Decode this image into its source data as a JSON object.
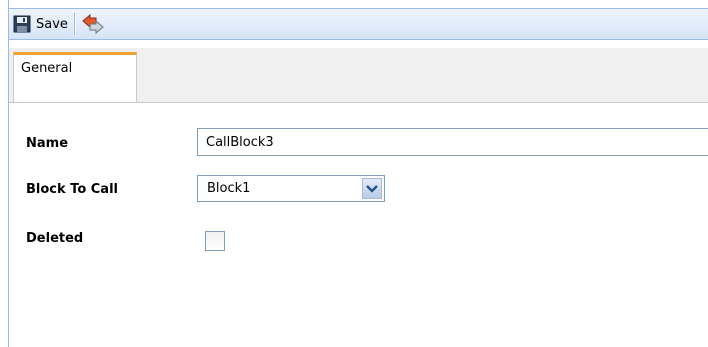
{
  "toolbar": {
    "save_label": "Save",
    "save_icon": "floppy-disk-icon",
    "undo_icon": "revert-arrows-icon"
  },
  "tabs": [
    {
      "label": "General",
      "active": true
    }
  ],
  "form": {
    "name": {
      "label": "Name",
      "value": "CallBlock3"
    },
    "block_to_call": {
      "label": "Block To Call",
      "selected": "Block1"
    },
    "deleted": {
      "label": "Deleted",
      "checked": false
    }
  },
  "colors": {
    "toolbar_border": "#99bbe8",
    "tab_accent": "#f0a030",
    "input_border": "#7f9db9"
  }
}
